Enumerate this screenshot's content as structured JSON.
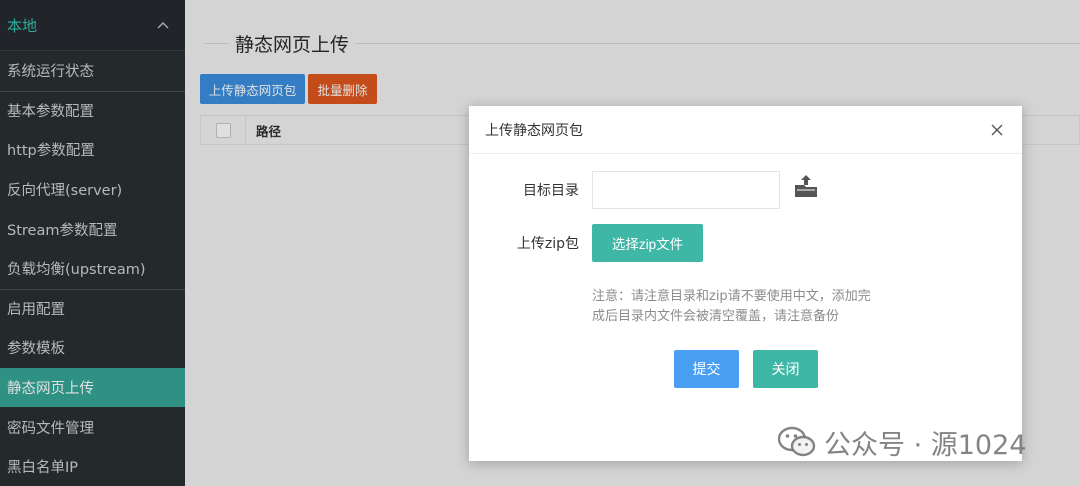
{
  "sidebar": {
    "group_label": "本地",
    "items": [
      {
        "label": "系统运行状态"
      },
      {
        "label": "基本参数配置"
      },
      {
        "label": "http参数配置"
      },
      {
        "label": "反向代理(server)"
      },
      {
        "label": "Stream参数配置"
      },
      {
        "label": "负载均衡(upstream)"
      },
      {
        "label": "启用配置"
      },
      {
        "label": "参数模板"
      },
      {
        "label": "静态网页上传"
      },
      {
        "label": "密码文件管理"
      },
      {
        "label": "黑白名单IP"
      }
    ],
    "active_index": 8
  },
  "main": {
    "page_title": "静态网页上传",
    "upload_button": "上传静态网页包",
    "batch_delete_button": "批量删除",
    "table": {
      "columns": [
        "路径"
      ]
    }
  },
  "dialog": {
    "title": "上传静态网页包",
    "target_dir_label": "目标目录",
    "target_dir_value": "",
    "zip_label": "上传zip包",
    "select_zip_button": "选择zip文件",
    "note_line1": "注意：请注意目录和zip请不要使用中文，添加完",
    "note_line2": "成后目录内文件会被清空覆盖，请注意备份",
    "submit_button": "提交",
    "close_button": "关闭"
  },
  "watermark": {
    "text": "公众号 · 源1024"
  },
  "colors": {
    "sidebar_bg": "#2a2f33",
    "sidebar_active": "#36a597",
    "group_accent": "#33c3b3",
    "primary_blue": "#3c8fe1",
    "danger_orange": "#e0571f",
    "teal": "#3fb7a7"
  },
  "icons": {
    "group_chevron": "chevron-up-icon",
    "dialog_close": "close-icon",
    "folder_upload": "folder-upload-icon",
    "watermark_logo": "wechat-icon"
  }
}
